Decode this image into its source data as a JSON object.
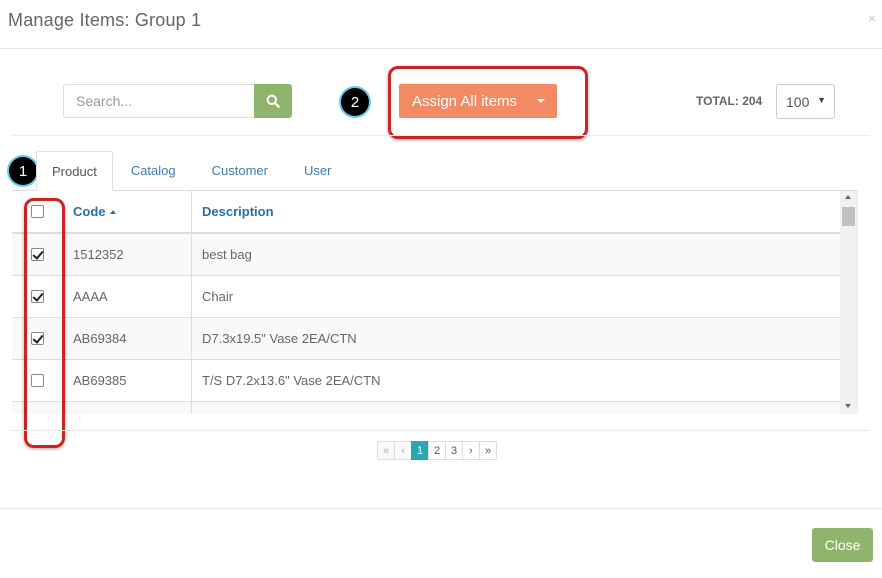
{
  "modal": {
    "title": "Manage Items: Group 1",
    "close_glyph": "×"
  },
  "search": {
    "placeholder": "Search...",
    "value": "",
    "icon": "search-icon"
  },
  "callouts": {
    "one": "1",
    "two": "2"
  },
  "assign_button": {
    "label": "Assign All items"
  },
  "total": {
    "label": "TOTAL: 204"
  },
  "page_size": {
    "value": "100",
    "arrow": "▼"
  },
  "tabs": [
    {
      "label": "Product",
      "active": true
    },
    {
      "label": "Catalog"
    },
    {
      "label": "Customer"
    },
    {
      "label": "User"
    }
  ],
  "table": {
    "headers": {
      "code": "Code",
      "description": "Description"
    },
    "rows": [
      {
        "code": "1512352",
        "description": "best bag",
        "checked": true
      },
      {
        "code": "AAAA",
        "description": "Chair",
        "checked": true
      },
      {
        "code": "AB69384",
        "description": "D7.3x19.5\" Vase 2EA/CTN",
        "checked": true
      },
      {
        "code": "AB69385",
        "description": "T/S D7.2x13.6\" Vase 2EA/CTN",
        "checked": false
      },
      {
        "code": "",
        "description": "",
        "checked": false
      }
    ]
  },
  "pagination": {
    "first": "«",
    "prev": "‹",
    "pages": [
      "1",
      "2",
      "3"
    ],
    "current": "1",
    "next": "›",
    "last": "»"
  },
  "footer": {
    "close_label": "Close"
  },
  "colors": {
    "assign_orange": "#f28a63",
    "close_green": "#8fb46b",
    "search_green": "#8fb46b",
    "pager_active": "#2aa7b0",
    "link_blue": "#3a7ab3",
    "annotation_red": "#cc2222"
  }
}
